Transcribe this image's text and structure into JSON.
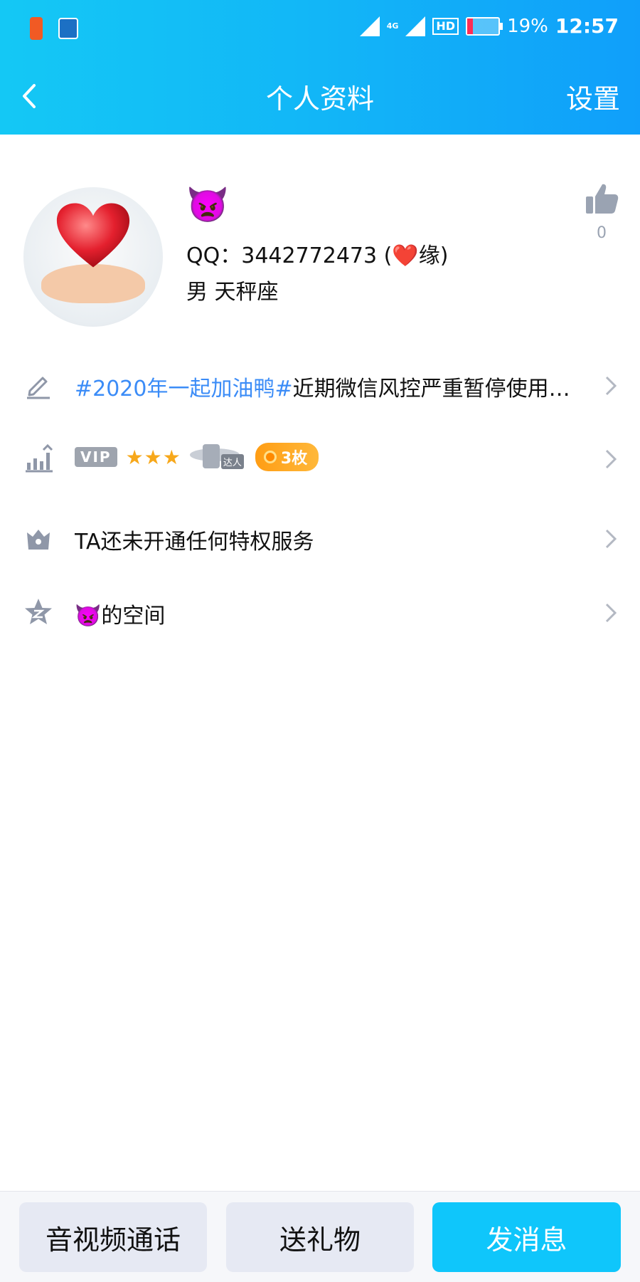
{
  "status_bar": {
    "time": "12:57",
    "battery_percent": "19%",
    "battery_level": 0.19,
    "network": "4G",
    "hd": "HD"
  },
  "nav": {
    "title": "个人资料",
    "settings": "设置",
    "back_icon": "chevron-left-icon"
  },
  "profile": {
    "nickname": "👿",
    "qq_prefix": "QQ：3442772473 (",
    "qq_heart": "❤️",
    "qq_suffix": "缘)",
    "gender_sign": "男  天秤座",
    "like_count": "0",
    "like_icon": "thumbs-up-icon"
  },
  "rows": {
    "signature": {
      "tag": "#2020年一起加油鸭#",
      "text": "近期微信风控严重暂停使用，…",
      "icon": "pencil-icon"
    },
    "level": {
      "vip": "VIP",
      "stars": "★★★",
      "daren": "达人",
      "coins": "3枚",
      "icon": "level-up-icon"
    },
    "privilege": {
      "text": "TA还未开通任何特权服务",
      "icon": "crown-icon"
    },
    "space": {
      "text": "👿的空间",
      "icon": "qzone-star-icon"
    }
  },
  "actions": {
    "call": "音视频通话",
    "gift": "送礼物",
    "message": "发消息"
  },
  "colors": {
    "header_start": "#14c8f5",
    "header_end": "#109ffa",
    "tag_blue": "#3b8cf7",
    "primary_button": "#0fc6fb",
    "secondary_button": "#e6e9f3"
  }
}
